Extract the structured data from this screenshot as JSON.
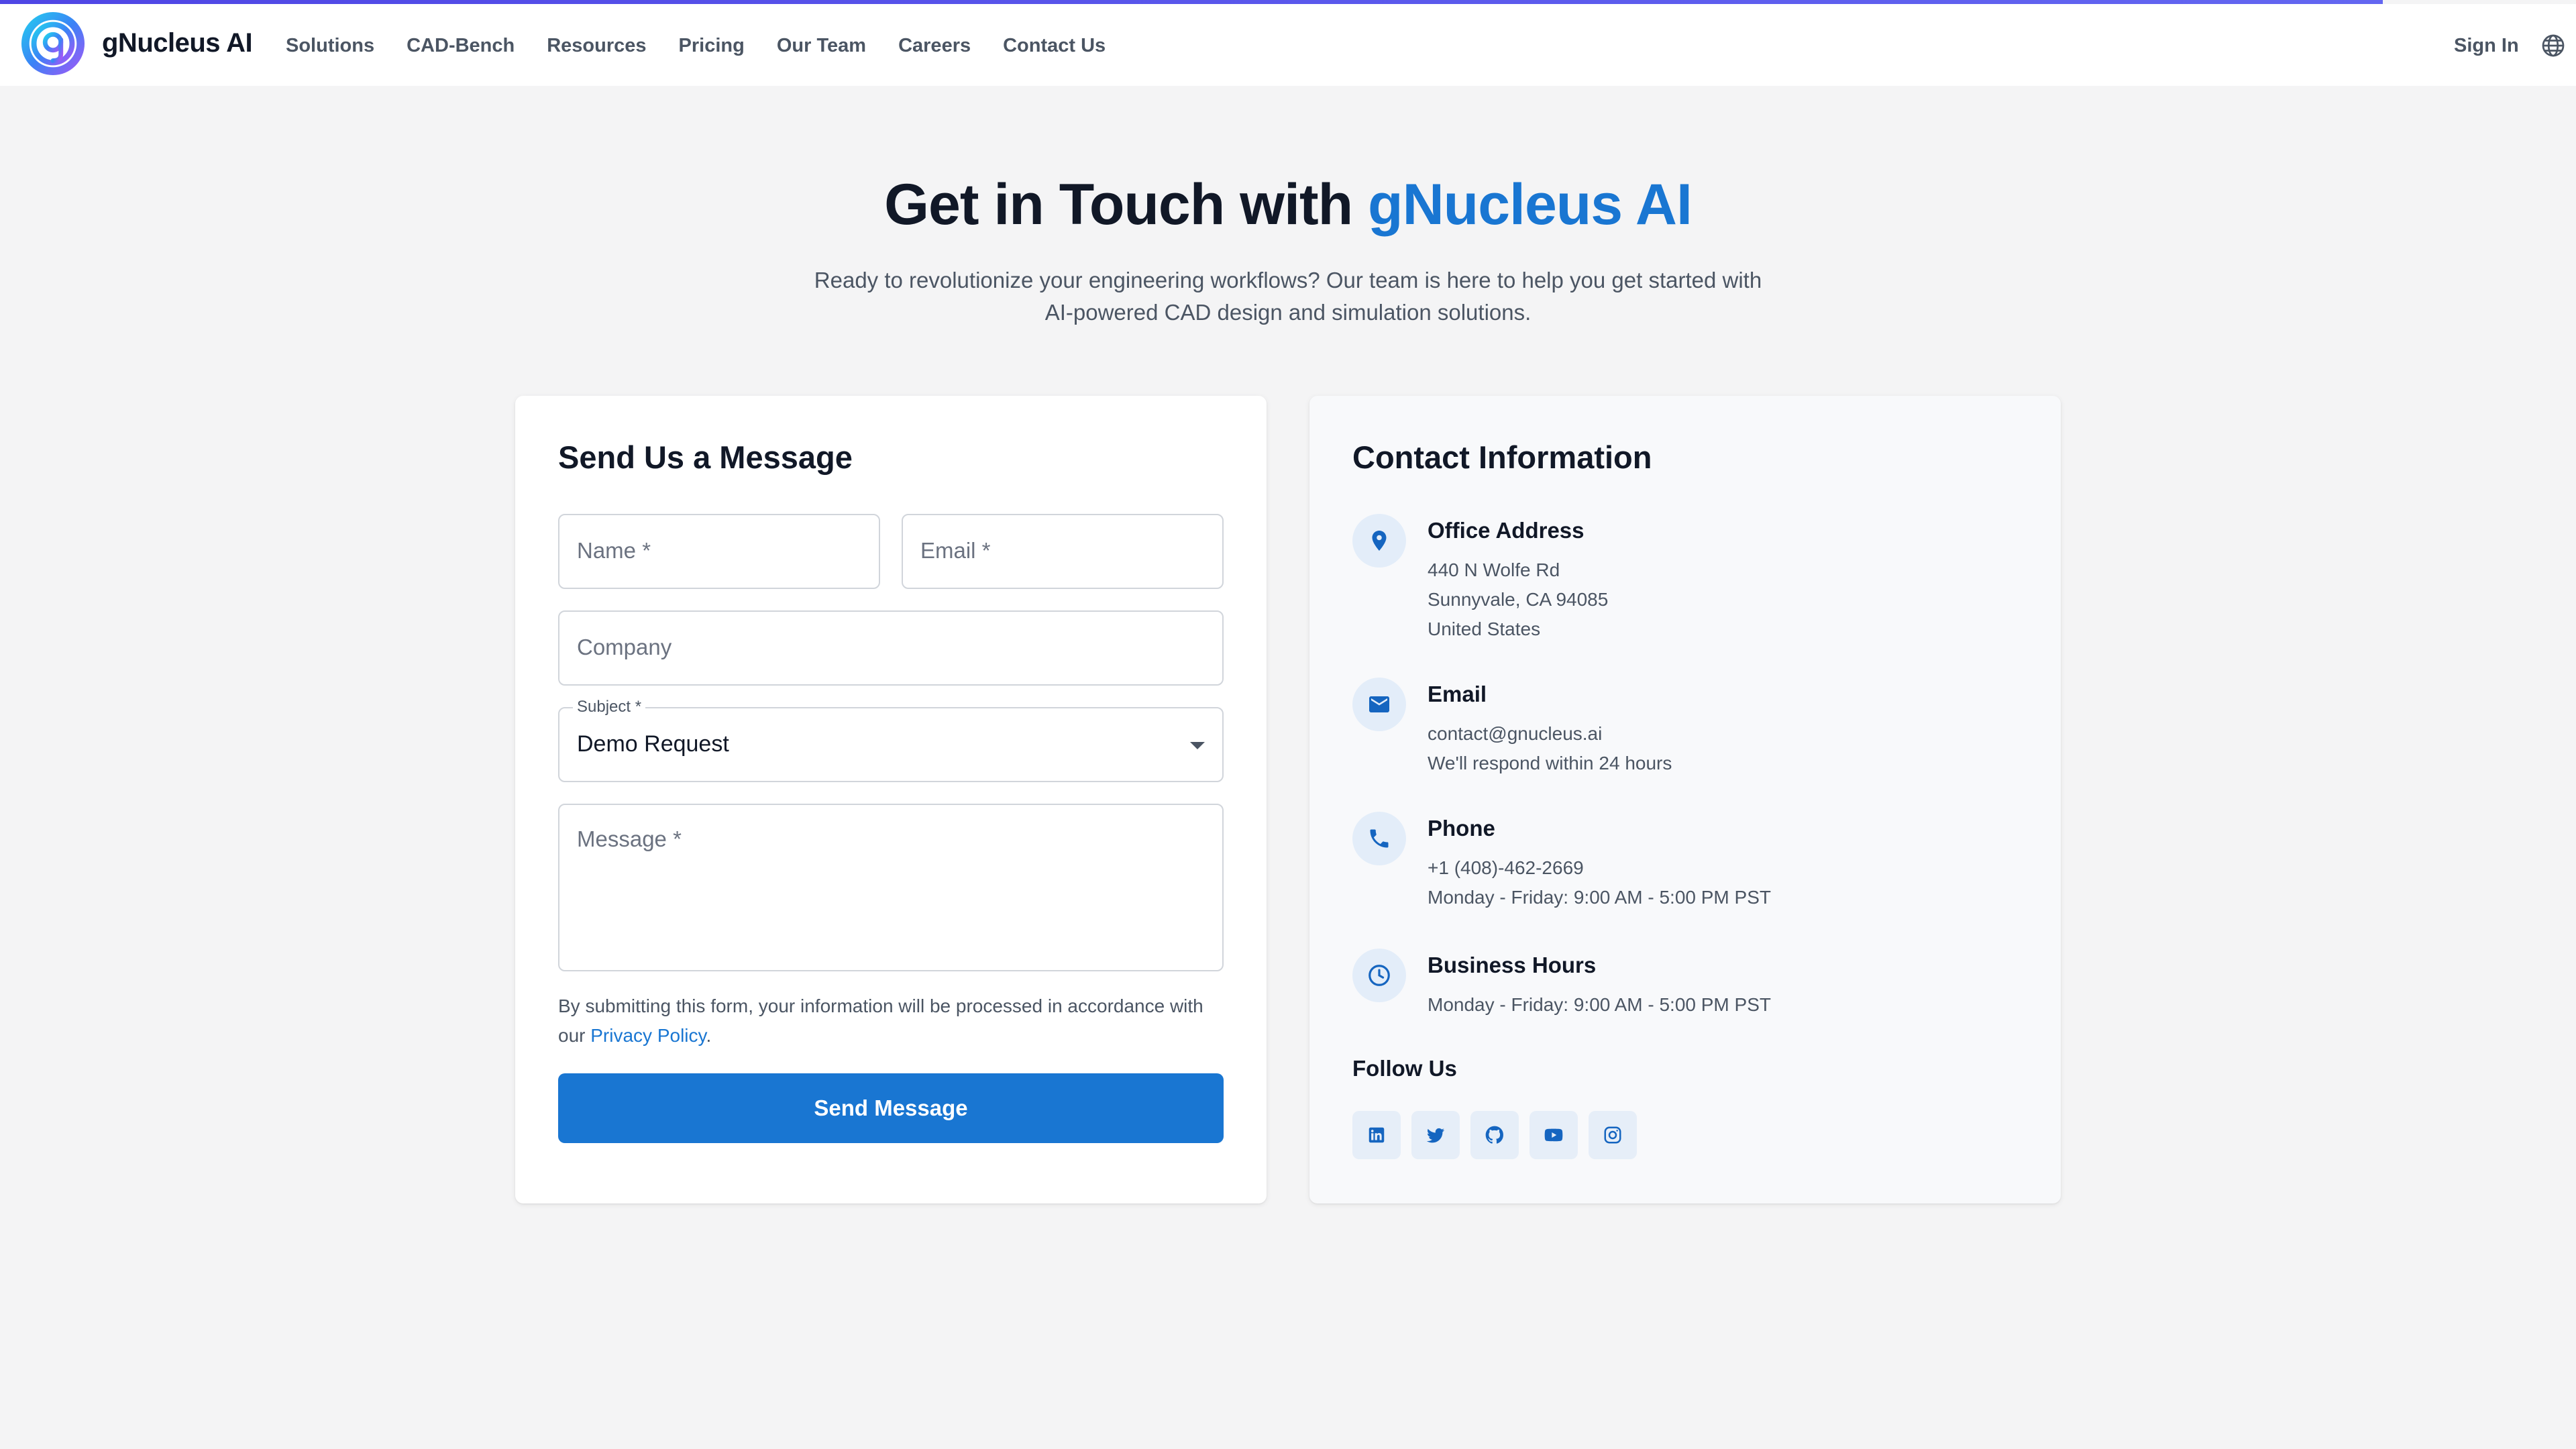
{
  "nav": {
    "brand": "gNucleus AI",
    "links": [
      "Solutions",
      "CAD-Bench",
      "Resources",
      "Pricing",
      "Our Team",
      "Careers",
      "Contact Us"
    ],
    "sign_in": "Sign In"
  },
  "hero": {
    "title_prefix": "Get in Touch with ",
    "title_accent": "gNucleus AI",
    "subtitle": "Ready to revolutionize your engineering workflows? Our team is here to help you get started with AI-powered CAD design and simulation solutions."
  },
  "form": {
    "title": "Send Us a Message",
    "name_placeholder": "Name *",
    "email_placeholder": "Email *",
    "company_placeholder": "Company",
    "subject_label": "Subject *",
    "subject_value": "Demo Request",
    "message_placeholder": "Message *",
    "disclaimer_text": "By submitting this form, your information will be processed in accordance with our ",
    "privacy_link": "Privacy Policy",
    "disclaimer_end": ".",
    "submit_label": "Send Message"
  },
  "contact": {
    "title": "Contact Information",
    "office": {
      "heading": "Office Address",
      "lines": [
        "440 N Wolfe Rd",
        "Sunnyvale, CA 94085",
        "United States"
      ]
    },
    "email": {
      "heading": "Email",
      "lines": [
        "contact@gnucleus.ai",
        "We'll respond within 24 hours"
      ]
    },
    "phone": {
      "heading": "Phone",
      "lines": [
        "+1 (408)-462-2669",
        "Monday - Friday: 9:00 AM - 5:00 PM PST"
      ]
    },
    "hours": {
      "heading": "Business Hours",
      "lines": [
        "Monday - Friday: 9:00 AM - 5:00 PM PST"
      ]
    },
    "follow_title": "Follow Us",
    "socials": [
      "linkedin-icon",
      "twitter-icon",
      "github-icon",
      "youtube-icon",
      "instagram-icon"
    ]
  },
  "colors": {
    "accent": "#1976d2",
    "progress": "#4f46e5",
    "background": "#f4f4f5"
  }
}
